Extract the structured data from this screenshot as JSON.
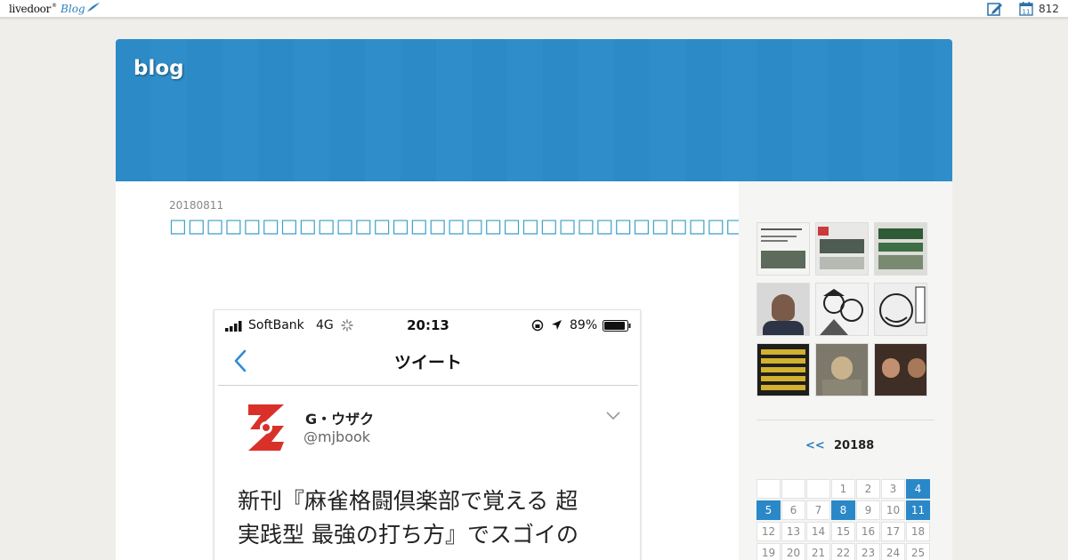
{
  "topbar": {
    "logo_text": "livedoor",
    "logo_blog": "Blog",
    "count": "812",
    "calendar_day": "11"
  },
  "header": {
    "title": "blog"
  },
  "post": {
    "date": "20180811",
    "title": "□□□□□□□□□□□□□□□□□□□□□□□□□□□□□□□□□□□□"
  },
  "screenshot": {
    "carrier": "SoftBank",
    "network": "4G",
    "time": "20:13",
    "battery": "89%",
    "nav_title": "ツイート",
    "user_name": "G・ウザク",
    "user_handle": "@mjbook",
    "tweet_line1": "新刊『麻雀格闘倶楽部で覚える 超",
    "tweet_line2": "実践型 最強の打ち方』でスゴイの"
  },
  "calendar": {
    "prev": "<<",
    "month": "20188",
    "accent": "#2a88c8",
    "days": [
      {
        "label": "",
        "hl": false
      },
      {
        "label": "",
        "hl": false
      },
      {
        "label": "",
        "hl": false
      },
      {
        "label": "1",
        "hl": false
      },
      {
        "label": "2",
        "hl": false
      },
      {
        "label": "3",
        "hl": false
      },
      {
        "label": "4",
        "hl": true
      },
      {
        "label": "5",
        "hl": true
      },
      {
        "label": "6",
        "hl": false
      },
      {
        "label": "7",
        "hl": false
      },
      {
        "label": "8",
        "hl": true
      },
      {
        "label": "9",
        "hl": false
      },
      {
        "label": "10",
        "hl": false
      },
      {
        "label": "11",
        "hl": true
      },
      {
        "label": "12",
        "hl": false
      },
      {
        "label": "13",
        "hl": false
      },
      {
        "label": "14",
        "hl": false
      },
      {
        "label": "15",
        "hl": false
      },
      {
        "label": "16",
        "hl": false
      },
      {
        "label": "17",
        "hl": false
      },
      {
        "label": "18",
        "hl": false
      },
      {
        "label": "19",
        "hl": false
      },
      {
        "label": "20",
        "hl": false
      },
      {
        "label": "21",
        "hl": false
      },
      {
        "label": "22",
        "hl": false
      },
      {
        "label": "23",
        "hl": false
      },
      {
        "label": "24",
        "hl": false
      },
      {
        "label": "25",
        "hl": false
      }
    ]
  },
  "colors": {
    "header": "#2c8ac6",
    "link": "#3aa0c8",
    "twitter_blue": "#2f8cd8",
    "avatar_red": "#d9302a"
  }
}
